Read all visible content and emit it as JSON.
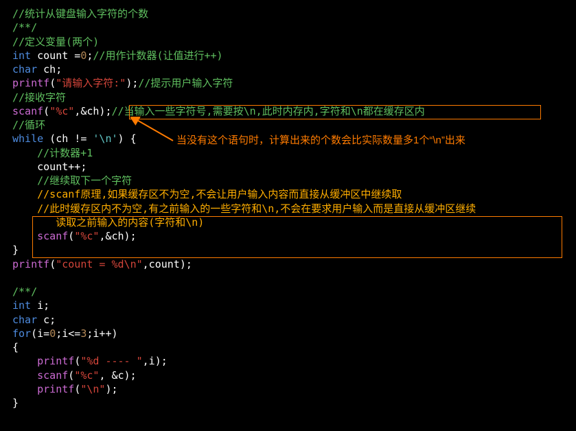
{
  "lines": {
    "l1": "//统计从键盘输入字符的个数",
    "l2": "/**/",
    "l3": "//定义变量(两个)",
    "l4a": "int",
    "l4b": " count =",
    "l4c": "0",
    "l4d": ";",
    "l4e": "//用作计数器(让值进行++)",
    "l5a": "char",
    "l5b": " ch;",
    "l6a": "printf",
    "l6b": "(",
    "l6c": "\"请输入字符:\"",
    "l6d": ");",
    "l6e": "//提示用户输入字符",
    "l7": "//接收字符",
    "l8a": "scanf",
    "l8b": "(",
    "l8c": "\"%c\"",
    "l8d": ",&ch);",
    "l8e": "//当输入一些字符号,需要按\\n,此时内存内,字符和\\n都在缓存区内",
    "l9": "//循环",
    "l10a": "while",
    "l10b": " (ch != ",
    "l10c": "'\\n'",
    "l10d": ") {",
    "l11": "    //计数器+1",
    "l12": "    count++;",
    "l13": "    //继续取下一个字符",
    "l14": "    //scanf原理,如果缓存区不为空,不会让用户输入内容而直接从缓冲区中继续取",
    "l15": "    //此时缓存区内不为空,有之前输入的一些字符和\\n,不会在要求用户输入而是直接从缓冲区继续\n       读取之前输入的内容(字符和\\n)",
    "l16a": "    ",
    "l16b": "scanf",
    "l16c": "(",
    "l16d": "\"%c\"",
    "l16e": ",&ch);",
    "l17": "}",
    "l18a": "printf",
    "l18b": "(",
    "l18c": "\"count = %d\\n\"",
    "l18d": ",count);",
    "l19": "",
    "l20": "/**/",
    "l21a": "int",
    "l21b": " i;",
    "l22a": "char",
    "l22b": " c;",
    "l23a": "for",
    "l23b": "(i=",
    "l23c": "0",
    "l23d": ";i<=",
    "l23e": "3",
    "l23f": ";i++)",
    "l24": "{",
    "l25a": "    ",
    "l25b": "printf",
    "l25c": "(",
    "l25d": "\"%d ---- \"",
    "l25e": ",i);",
    "l26a": "    ",
    "l26b": "scanf",
    "l26c": "(",
    "l26d": "\"%c\"",
    "l26e": ", &c);",
    "l27a": "    ",
    "l27b": "printf",
    "l27c": "(",
    "l27d": "\"\\n\"",
    "l27e": ");",
    "l28": "}"
  },
  "annotation": "当没有这个语句时，计算出来的个数会比实际数量多1个“\\n”出来"
}
